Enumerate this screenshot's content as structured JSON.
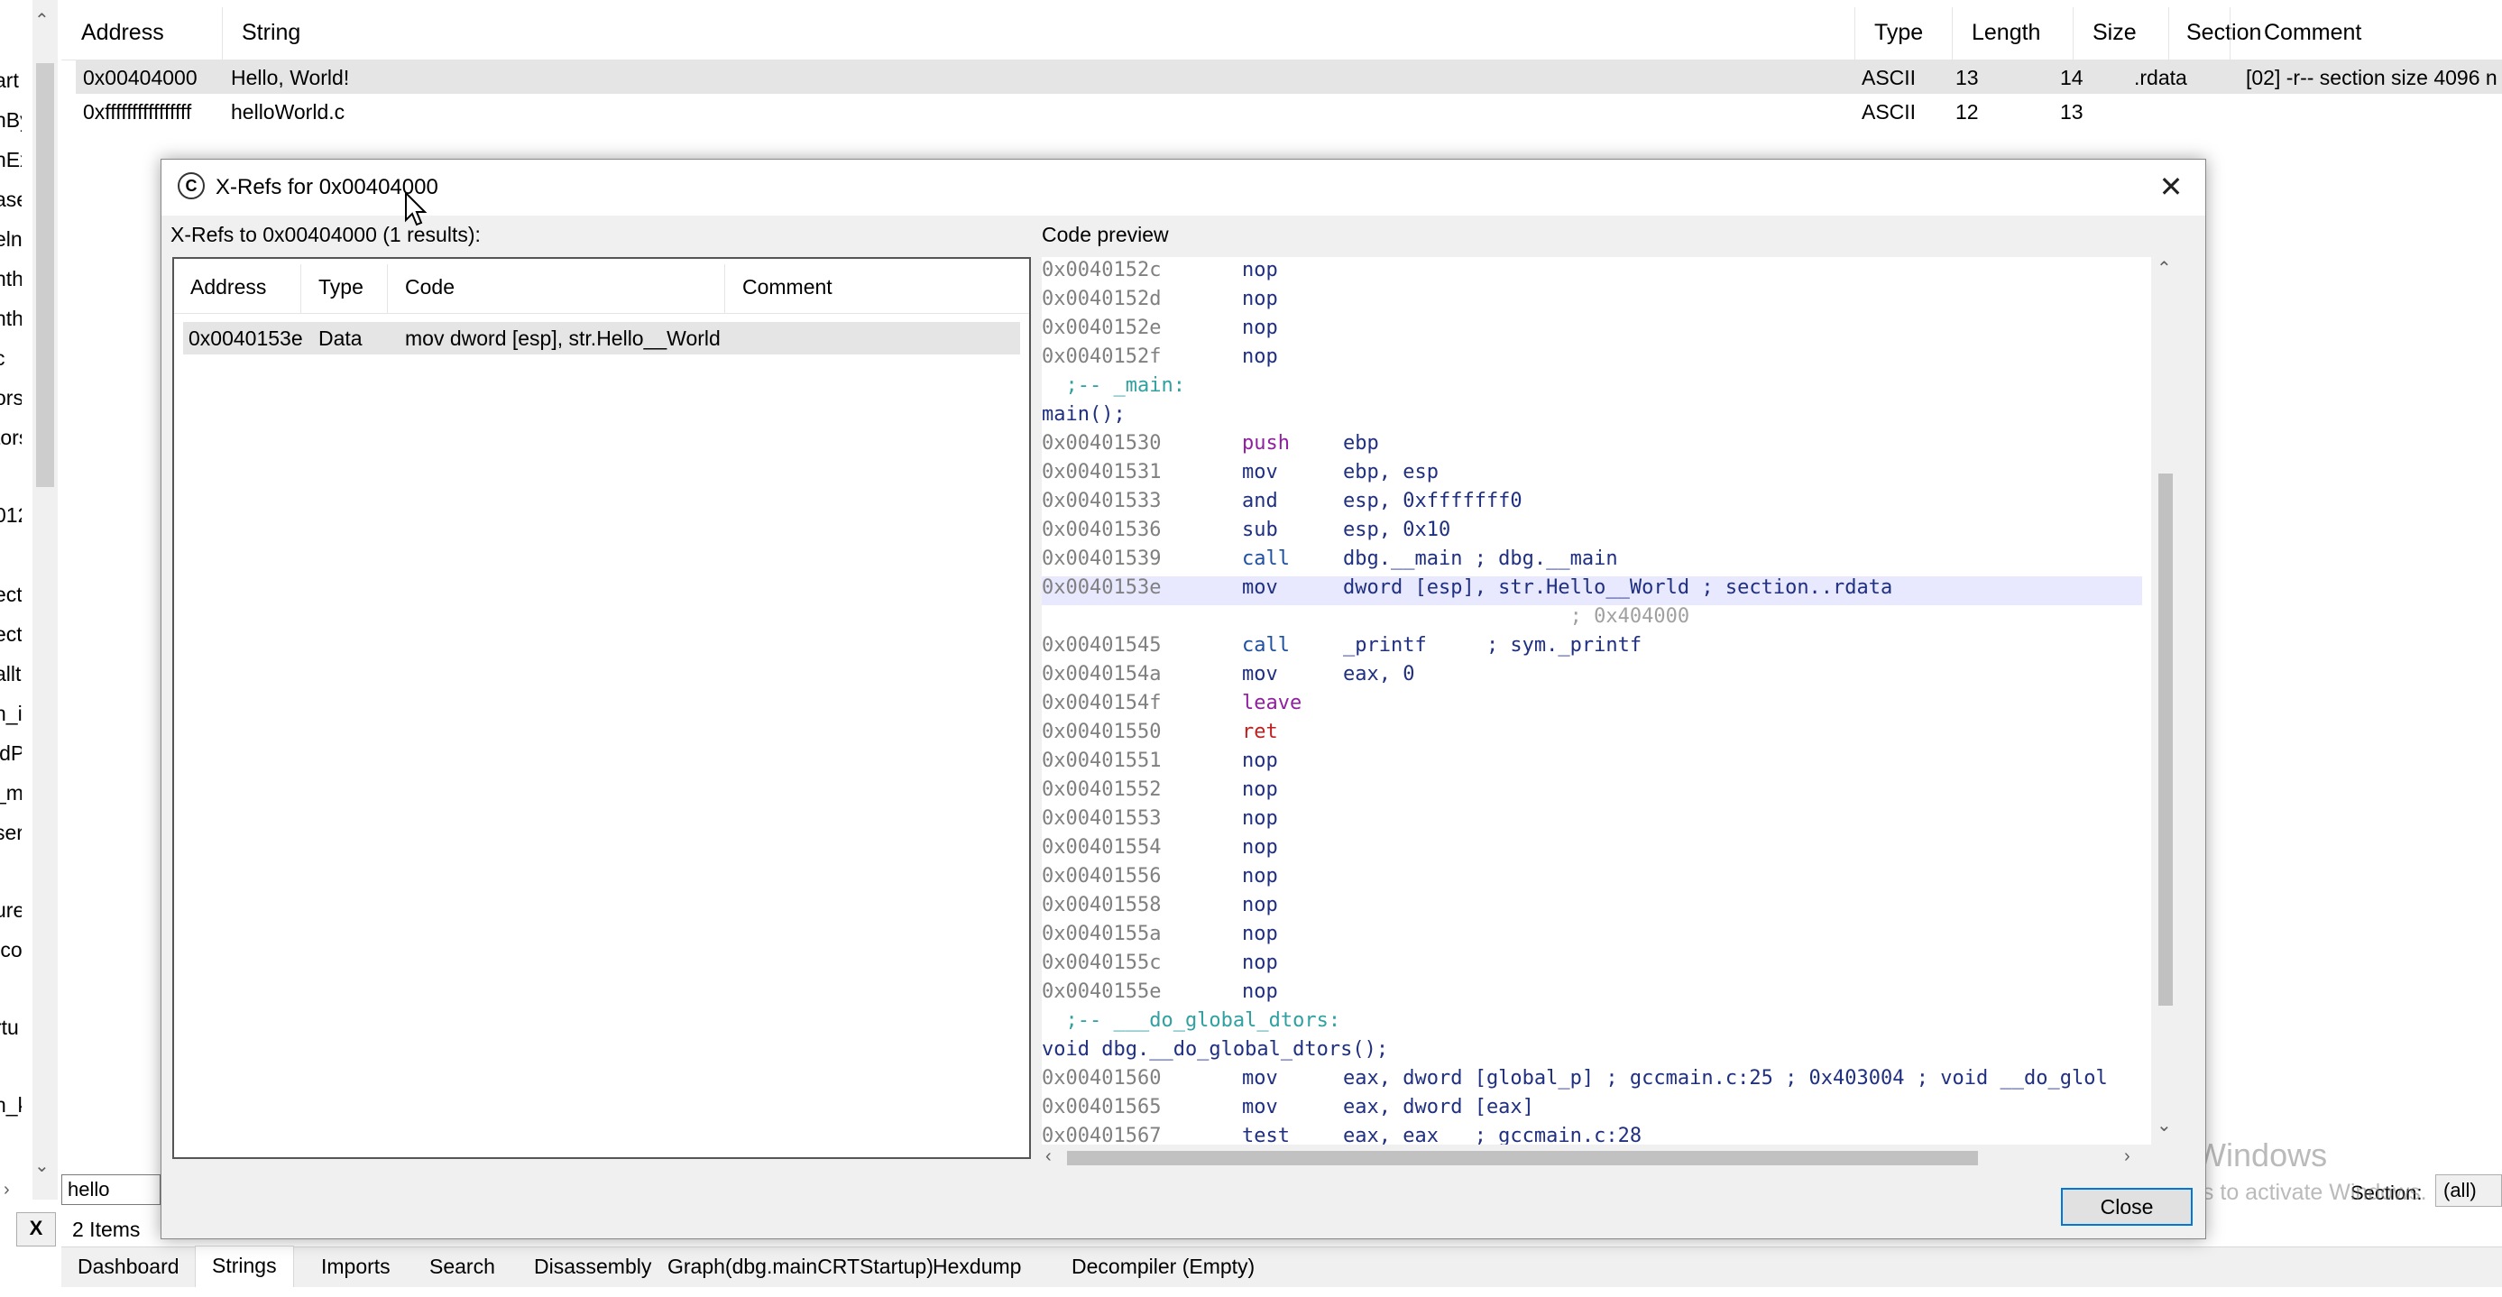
{
  "left_tree": {
    "fragments": [
      "art",
      "nBy",
      "nEx",
      "ase",
      "eln(",
      "nthr",
      "nthr",
      "c",
      "ors",
      "tors",
      "012",
      "ect",
      "ect",
      "allt",
      "n_i",
      "idP",
      "_m",
      "seri",
      "ure",
      ".co",
      "rtu",
      "n_k"
    ]
  },
  "strings_table": {
    "columns": {
      "address": "Address",
      "string": "String",
      "type": "Type",
      "length": "Length",
      "size": "Size",
      "section": "Section",
      "comment": "Comment"
    },
    "rows": [
      {
        "address": "0x00404000",
        "string": "Hello, World!",
        "type": "ASCII",
        "length": "13",
        "size": "14",
        "section": ".rdata",
        "comment": "[02] -r-- section size 4096 n"
      },
      {
        "address": "0xffffffffffffffff",
        "string": "helloWorld.c",
        "type": "ASCII",
        "length": "12",
        "size": "13",
        "section": "",
        "comment": ""
      }
    ]
  },
  "filter": {
    "search_value": "hello",
    "clear_label": "X",
    "items_count": "2 Items",
    "section_label": "Section:",
    "section_value": "(all)"
  },
  "tabs": [
    {
      "label": "Dashboard",
      "active": false
    },
    {
      "label": "Strings",
      "active": true
    },
    {
      "label": "Imports",
      "active": false
    },
    {
      "label": "Search",
      "active": false
    },
    {
      "label": "Disassembly",
      "active": false
    },
    {
      "label": "Graph(dbg.mainCRTStartup)",
      "active": false
    },
    {
      "label": "Hexdump",
      "active": false
    },
    {
      "label": "Decompiler (Empty)",
      "active": false
    }
  ],
  "dialog": {
    "title": "X-Refs for 0x00404000",
    "xref_label": "X-Refs to 0x00404000 (1 results):",
    "preview_label": "Code preview",
    "close_button": "Close",
    "xref_columns": {
      "address": "Address",
      "type": "Type",
      "code": "Code",
      "comment": "Comment"
    },
    "xref_rows": [
      {
        "address": "0x0040153e",
        "type": "Data",
        "code": "mov dword [esp], str.Hello__World",
        "comment": ""
      }
    ]
  },
  "code_preview": {
    "highlight_color": "#e8e8ff",
    "lines": [
      {
        "addr": "0x0040152c",
        "op": "nop",
        "args": ""
      },
      {
        "addr": "0x0040152d",
        "op": "nop",
        "args": ""
      },
      {
        "addr": "0x0040152e",
        "op": "nop",
        "args": ""
      },
      {
        "addr": "0x0040152f",
        "op": "nop",
        "args": ""
      },
      {
        "label": "  ;-- _main:"
      },
      {
        "label": "main();"
      },
      {
        "addr": "0x00401530",
        "op": "push",
        "args": "ebp"
      },
      {
        "addr": "0x00401531",
        "op": "mov",
        "args": "ebp, esp"
      },
      {
        "addr": "0x00401533",
        "op": "and",
        "args": "esp, 0xfffffff0"
      },
      {
        "addr": "0x00401536",
        "op": "sub",
        "args": "esp, 0x10"
      },
      {
        "addr": "0x00401539",
        "op": "call",
        "args": "dbg.__main ; dbg.__main"
      },
      {
        "addr": "0x0040153e",
        "op": "mov",
        "args": "dword [esp], str.Hello__World ; section..rdata",
        "hl": true
      },
      {
        "addr": "",
        "op": "",
        "args": "                   ; 0x404000"
      },
      {
        "addr": "0x00401545",
        "op": "call",
        "args": "_printf     ; sym._printf"
      },
      {
        "addr": "0x0040154a",
        "op": "mov",
        "args": "eax, 0"
      },
      {
        "addr": "0x0040154f",
        "op": "leave",
        "args": ""
      },
      {
        "addr": "0x00401550",
        "op": "ret",
        "args": ""
      },
      {
        "addr": "0x00401551",
        "op": "nop",
        "args": ""
      },
      {
        "addr": "0x00401552",
        "op": "nop",
        "args": ""
      },
      {
        "addr": "0x00401553",
        "op": "nop",
        "args": ""
      },
      {
        "addr": "0x00401554",
        "op": "nop",
        "args": ""
      },
      {
        "addr": "0x00401556",
        "op": "nop",
        "args": ""
      },
      {
        "addr": "0x00401558",
        "op": "nop",
        "args": ""
      },
      {
        "addr": "0x0040155a",
        "op": "nop",
        "args": ""
      },
      {
        "addr": "0x0040155c",
        "op": "nop",
        "args": ""
      },
      {
        "addr": "0x0040155e",
        "op": "nop",
        "args": ""
      },
      {
        "label": "  ;-- ___do_global_dtors:"
      },
      {
        "label": "void dbg.__do_global_dtors();"
      },
      {
        "addr": "0x00401560",
        "op": "mov",
        "args": "eax, dword [global_p] ; gccmain.c:25 ; 0x403004 ; void __do_glol"
      },
      {
        "addr": "0x00401565",
        "op": "mov",
        "args": "eax, dword [eax]"
      },
      {
        "addr": "0x00401567",
        "op": "test",
        "args": "eax, eax   ; gccmain.c:28"
      }
    ]
  },
  "watermark": {
    "line1": "Activate Windows",
    "line2": "Go to Settings to activate Windows."
  },
  "icons": {
    "title_icon": "cutter-logo-icon",
    "close": "close-icon",
    "scroll_up": "chevron-up-icon",
    "scroll_down": "chevron-down-icon"
  }
}
